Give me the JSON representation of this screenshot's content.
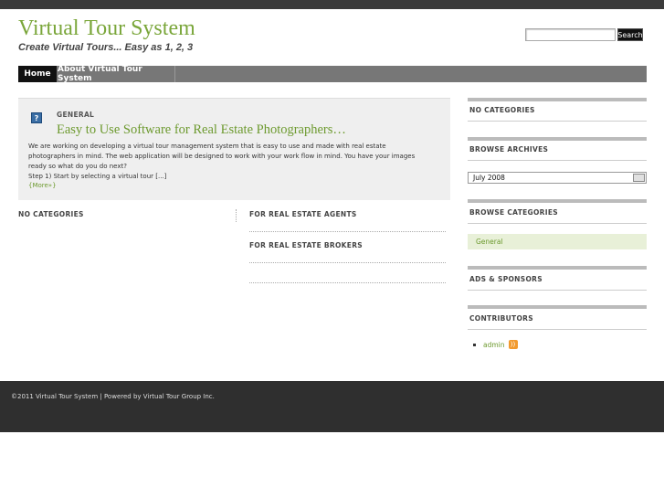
{
  "header": {
    "title": "Virtual Tour System",
    "tagline": "Create Virtual Tours... Easy as 1, 2, 3"
  },
  "search": {
    "placeholder": "",
    "button_label": "Search"
  },
  "nav": {
    "items": [
      {
        "label": "Home"
      },
      {
        "label": "About Virtual Tour System"
      }
    ]
  },
  "post": {
    "icon": "document-icon",
    "category": "GENERAL",
    "title": "Easy to Use Software for Real Estate Photographers…",
    "body_lines": [
      "We are working on developing a virtual tour management system that is easy to use and made with real estate",
      "photographers in mind.  The web application will be designed to work with your work flow in mind.  You have your images",
      "ready so what do you do next?",
      "Step 1) Start by selecting a virtual tour [...]"
    ],
    "more_label": "{More»}"
  },
  "columns": {
    "left_heading": "NO CATEGORIES",
    "agents_heading": "FOR REAL ESTATE AGENTS",
    "brokers_heading": "FOR REAL ESTATE BROKERS"
  },
  "sidebar": {
    "no_categories": "NO CATEGORIES",
    "browse_archives": "BROWSE ARCHIVES",
    "archive_selected": "July 2008",
    "browse_categories": "BROWSE CATEGORIES",
    "category_general": "General",
    "ads_sponsors": "ADS & SPONSORS",
    "contributors": "CONTRIBUTORS",
    "contributor_name": "admin"
  },
  "footer": {
    "copyright": "©2011 Virtual Tour System | Powered by ",
    "powered_by": "Virtual Tour Group Inc."
  },
  "colors": {
    "accent_green": "#7aa63a",
    "nav_dark": "#111111",
    "footer_bg": "#2f2f2f"
  }
}
